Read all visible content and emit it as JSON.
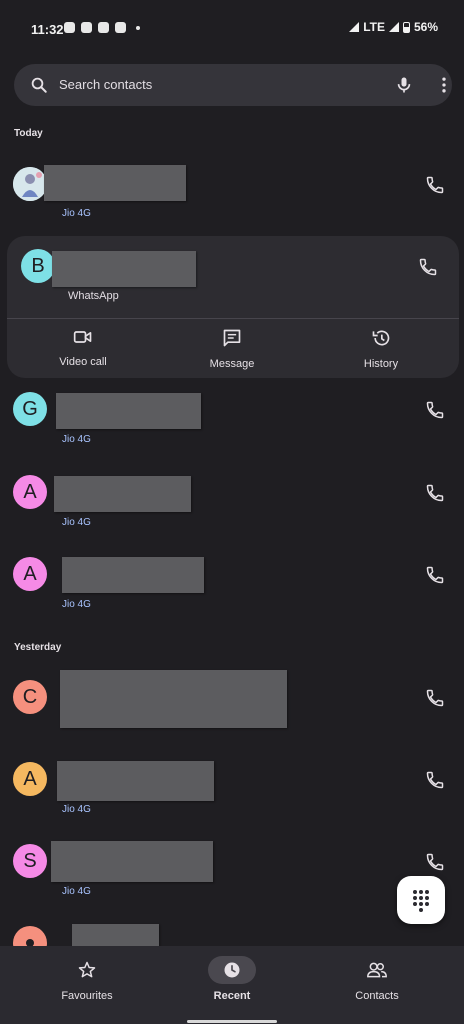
{
  "status_bar": {
    "time": "11:32",
    "network": "LTE",
    "battery": "56%"
  },
  "search": {
    "placeholder": "Search contacts"
  },
  "sections": {
    "today": "Today",
    "yesterday": "Yesterday"
  },
  "expanded_contact": {
    "initial": "B",
    "subtitle": "WhatsApp",
    "actions": [
      {
        "label": "Video call",
        "icon": "video-call-icon"
      },
      {
        "label": "Message",
        "icon": "message-icon"
      },
      {
        "label": "History",
        "icon": "history-icon"
      }
    ]
  },
  "recents": [
    {
      "initial": "",
      "subtitle": "Jio 4G",
      "avatar_color": "#cfe3e8",
      "photo": true
    },
    {
      "initial": "G",
      "subtitle": "Jio 4G",
      "avatar_color": "#7ee0e6"
    },
    {
      "initial": "A",
      "subtitle": "Jio 4G",
      "avatar_color": "#f58ae6"
    },
    {
      "initial": "A",
      "subtitle": "Jio 4G",
      "avatar_color": "#f58ae6"
    },
    {
      "initial": "C",
      "subtitle": "",
      "avatar_color": "#f5907e"
    },
    {
      "initial": "A",
      "subtitle": "Jio 4G",
      "avatar_color": "#f5b860"
    },
    {
      "initial": "S",
      "subtitle": "Jio 4G",
      "avatar_color": "#f58ae6"
    }
  ],
  "bottom_nav": [
    {
      "label": "Favourites",
      "icon": "star-icon"
    },
    {
      "label": "Recent",
      "icon": "clock-icon",
      "active": true
    },
    {
      "label": "Contacts",
      "icon": "contacts-icon"
    }
  ],
  "colors": {
    "background": "#1f1e22",
    "accent_subtitle": "#a9c4ff",
    "card": "#2d2c31"
  }
}
